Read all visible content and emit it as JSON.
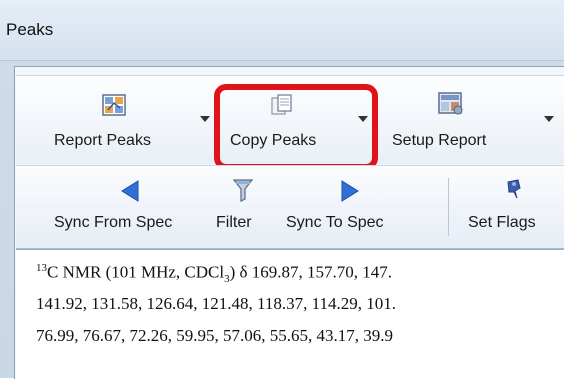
{
  "window": {
    "title": "Peaks"
  },
  "toolbar_top": {
    "report_peaks_label": "Report Peaks",
    "copy_peaks_label": "Copy Peaks",
    "setup_report_label": "Setup Report"
  },
  "toolbar_bottom": {
    "sync_from_spec_label": "Sync From Spec",
    "filter_label": "Filter",
    "sync_to_spec_label": "Sync To Spec",
    "set_flags_label": "Set Flags"
  },
  "report": {
    "isotope": "13",
    "line1_rest": "C NMR (101 MHz, CDCl",
    "line1_sub": "3",
    "line1_end": ") δ 169.87, 157.70, 147.",
    "line2": "141.92, 131.58, 126.64, 121.48, 118.37, 114.29, 101.",
    "line3": "76.99, 76.67, 72.26, 59.95, 57.06, 55.65, 43.17, 39.9"
  },
  "colors": {
    "highlight": "#e0131a",
    "arrow_blue": "#2f6fd6",
    "pin_blue": "#3a5fb0"
  },
  "icons": {
    "report_peaks": "report-peaks-icon",
    "copy_peaks": "copy-peaks-icon",
    "setup_report": "setup-report-icon",
    "sync_from_spec": "arrow-left-icon",
    "filter": "filter-icon",
    "sync_to_spec": "arrow-right-icon",
    "set_flags": "pin-icon"
  }
}
